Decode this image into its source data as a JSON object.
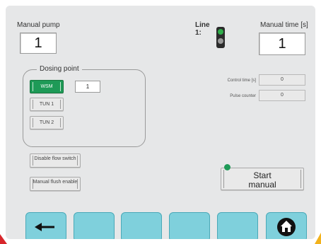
{
  "manual_pump": {
    "label": "Manual pump",
    "value": "1"
  },
  "line": {
    "label": "Line 1:"
  },
  "manual_time": {
    "label": "Manual time [s]",
    "value": "1"
  },
  "dosing": {
    "title": "Dosing point",
    "items": [
      {
        "label": "WSM",
        "active": true
      },
      {
        "label": "TUN 1",
        "active": false
      },
      {
        "label": "TUN 2",
        "active": false
      }
    ],
    "wsm_value": "1"
  },
  "stats": {
    "control_time_label": "Control time [s]",
    "control_time_value": "0",
    "pulse_counter_label": "Pulse counter",
    "pulse_counter_value": "0"
  },
  "buttons": {
    "disable_flow": "Disable flow switch",
    "manual_flush": "Manual flush enable",
    "start_manual": "Start manual"
  },
  "icons": {
    "back": "left-arrow-icon",
    "home": "home-icon"
  },
  "colors": {
    "accent_green": "#1e9a57",
    "nav_blue": "#7fd0dc",
    "traffic_green": "#2fae4a",
    "corner_red": "#d7262b",
    "corner_yellow": "#f2b21c"
  }
}
